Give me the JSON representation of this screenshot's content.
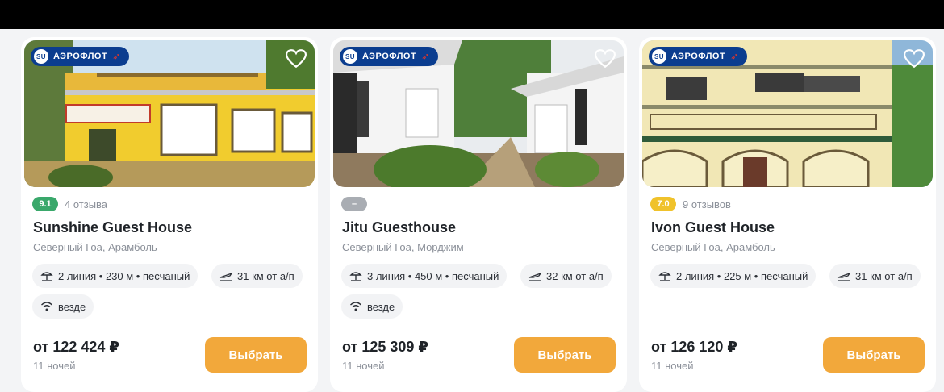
{
  "airline_badge": {
    "label": "АЭРОФЛОТ",
    "logo_text": "SU"
  },
  "colors": {
    "accent": "#f2a83b",
    "airline": "#0b3d8f",
    "rating_green": "#3aa86b",
    "rating_gray": "#a9adb3",
    "rating_yellow": "#f0c22b"
  },
  "icons": {
    "favorite": "heart-icon",
    "beach": "beach-icon",
    "airport": "plane-icon",
    "wifi": "wifi-icon"
  },
  "hotels": [
    {
      "rating": "9.1",
      "reviews": "4 отзыва",
      "name": "Sunshine Guest House",
      "location": "Северный Гоа, Арамболь",
      "beach": "2 линия • 230 м • песчаный",
      "airport": "31 км от а/п",
      "wifi": "везде",
      "price": "от 122 424 ₽",
      "nights": "11 ночей",
      "button": "Выбрать"
    },
    {
      "rating": "–",
      "reviews": "",
      "name": "Jitu Guesthouse",
      "location": "Северный Гоа, Морджим",
      "beach": "3 линия • 450 м • песчаный",
      "airport": "32 км от а/п",
      "wifi": "везде",
      "price": "от 125 309 ₽",
      "nights": "11 ночей",
      "button": "Выбрать"
    },
    {
      "rating": "7.0",
      "reviews": "9 отзывов",
      "name": "Ivon Guest House",
      "location": "Северный Гоа, Арамболь",
      "beach": "2 линия • 225 м • песчаный",
      "airport": "31 км от а/п",
      "wifi": "",
      "price": "от 126 120 ₽",
      "nights": "11 ночей",
      "button": "Выбрать"
    }
  ]
}
